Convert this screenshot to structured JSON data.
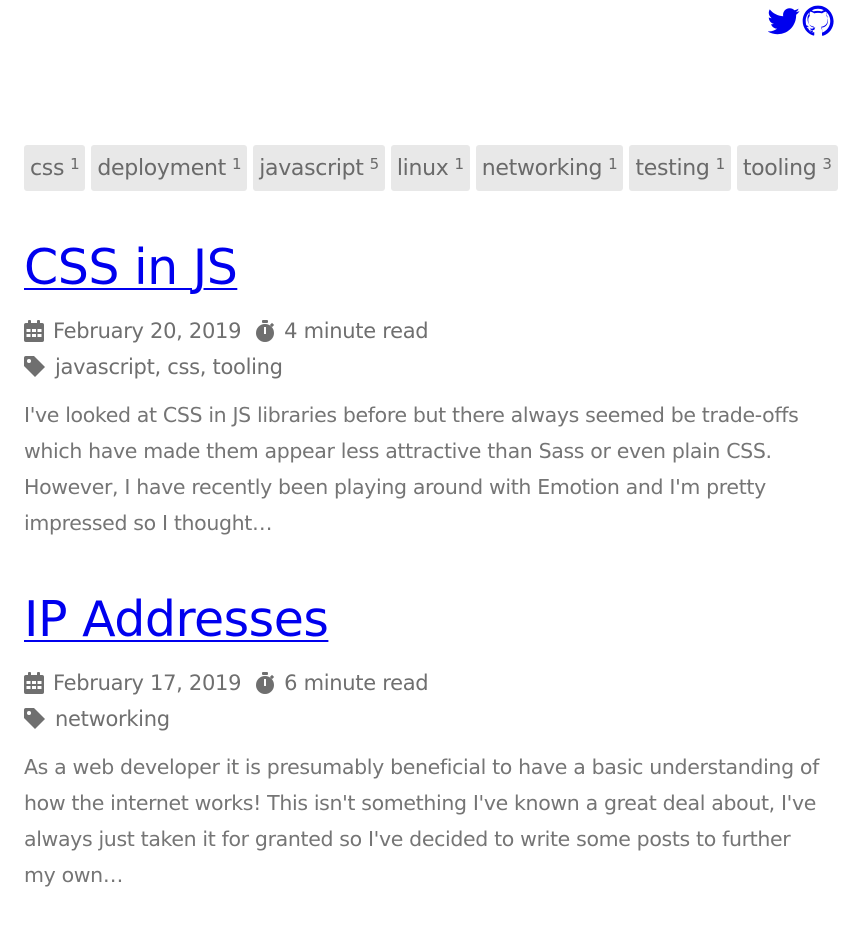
{
  "header": {
    "social": [
      {
        "name": "twitter",
        "icon": "twitter-icon"
      },
      {
        "name": "github",
        "icon": "github-icon"
      }
    ]
  },
  "tags": [
    {
      "label": "css",
      "count": "1"
    },
    {
      "label": "deployment",
      "count": "1"
    },
    {
      "label": "javascript",
      "count": "5"
    },
    {
      "label": "linux",
      "count": "1"
    },
    {
      "label": "networking",
      "count": "1"
    },
    {
      "label": "testing",
      "count": "1"
    },
    {
      "label": "tooling",
      "count": "3"
    }
  ],
  "posts": [
    {
      "title": "CSS in JS",
      "date": "February 20, 2019",
      "read_time": "4 minute read",
      "tags": "javascript, css, tooling",
      "excerpt": "I've looked at CSS in JS libraries before but there always seemed be trade-offs which have made them appear less attractive than Sass or even plain CSS. However, I have recently been playing around with Emotion and I'm pretty impressed so I thought…"
    },
    {
      "title": "IP Addresses",
      "date": "February 17, 2019",
      "read_time": "6 minute read",
      "tags": "networking",
      "excerpt": "As a web developer it is presumably beneficial to have a basic understanding of how the internet works! This isn't something I've known a great deal about, I've always just taken it for granted so I've decided to write some posts to further my own…"
    }
  ],
  "icons": {
    "date": "calendar-icon",
    "read_time": "stopwatch-icon",
    "tags": "tag-icon"
  },
  "colors": {
    "link": "#0000ee",
    "text": "#707070",
    "tag_bg": "#e8e8e8"
  }
}
